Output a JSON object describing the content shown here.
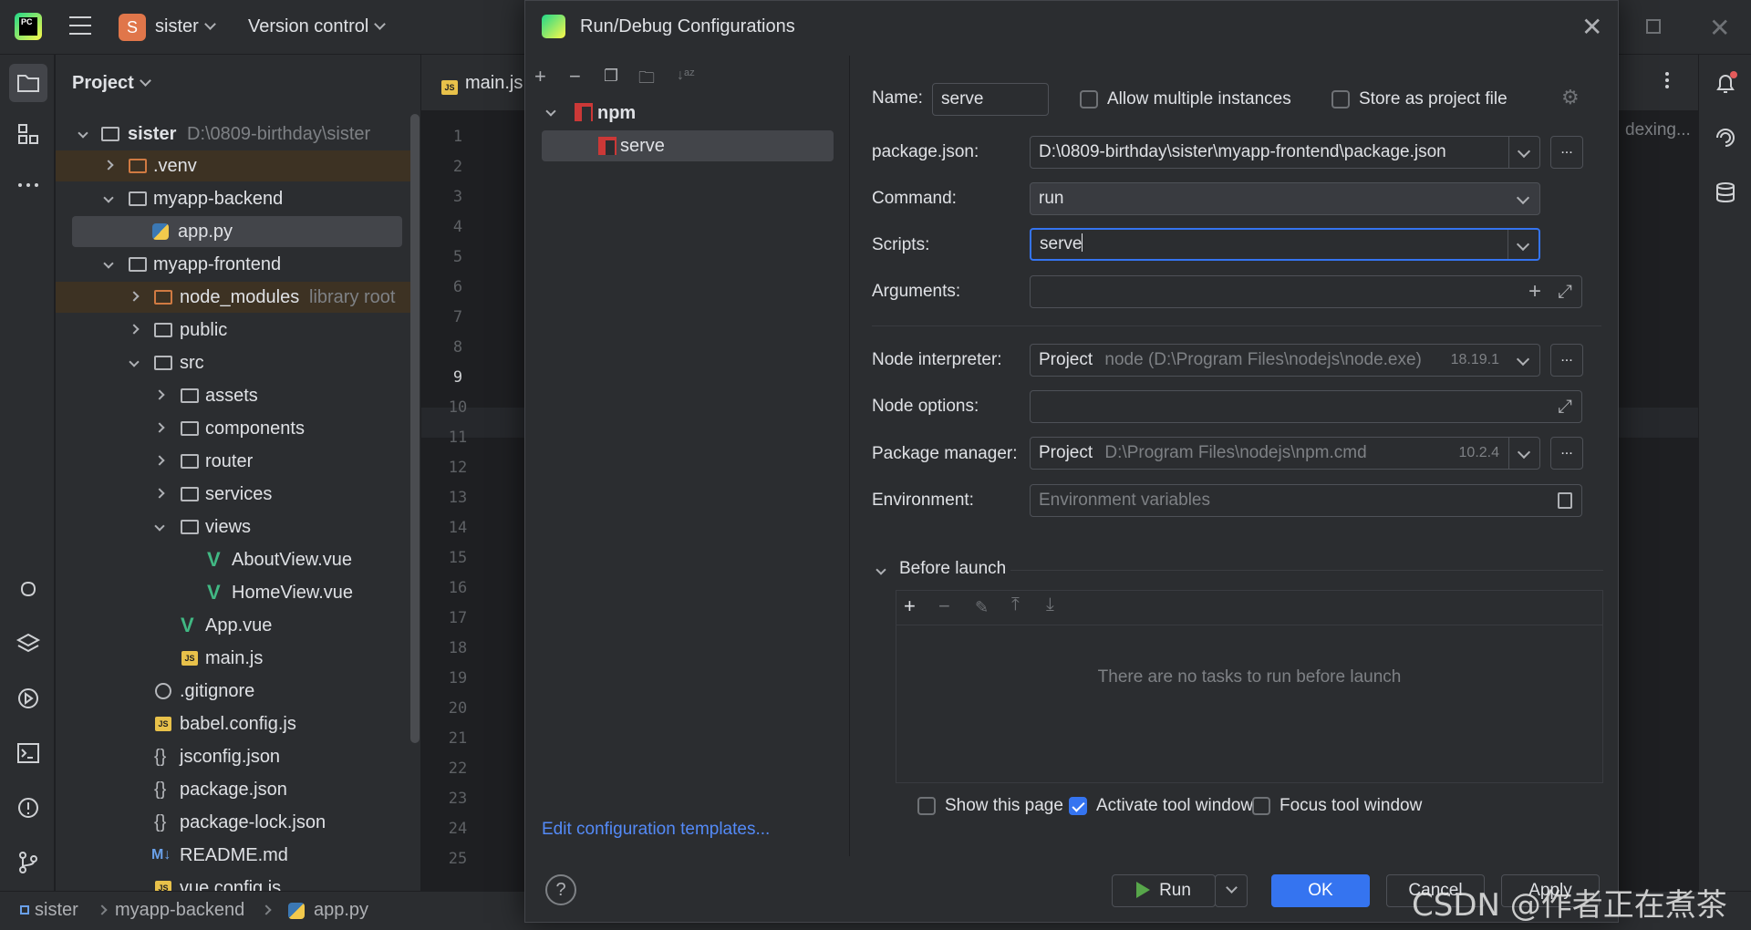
{
  "titlebar": {
    "project_initial": "S",
    "project_name": "sister",
    "vcs_label": "Version control"
  },
  "project_panel": {
    "title": "Project",
    "tree": [
      {
        "name": "sister",
        "path": "D:\\0809-birthday\\sister"
      },
      {
        "name": ".venv"
      },
      {
        "name": "myapp-backend"
      },
      {
        "name": "app.py"
      },
      {
        "name": "myapp-frontend"
      },
      {
        "name": "node_modules",
        "hint": "library root"
      },
      {
        "name": "public"
      },
      {
        "name": "src"
      },
      {
        "name": "assets"
      },
      {
        "name": "components"
      },
      {
        "name": "router"
      },
      {
        "name": "services"
      },
      {
        "name": "views"
      },
      {
        "name": "AboutView.vue"
      },
      {
        "name": "HomeView.vue"
      },
      {
        "name": "App.vue"
      },
      {
        "name": "main.js"
      },
      {
        "name": ".gitignore"
      },
      {
        "name": "babel.config.js"
      },
      {
        "name": "jsconfig.json"
      },
      {
        "name": "package.json"
      },
      {
        "name": "package-lock.json"
      },
      {
        "name": "README.md"
      },
      {
        "name": "vue.config.js"
      }
    ]
  },
  "editor": {
    "tab": "main.js",
    "line_numbers": [
      "1",
      "2",
      "3",
      "4",
      "5",
      "6",
      "7",
      "8",
      "9",
      "10",
      "11",
      "12",
      "13",
      "14",
      "15",
      "16",
      "17",
      "18",
      "19",
      "20",
      "21",
      "22",
      "23",
      "24",
      "25"
    ],
    "indexing": "dexing..."
  },
  "dialog": {
    "title": "Run/Debug Configurations",
    "tree": {
      "group": "npm",
      "item": "serve"
    },
    "edit_templates": "Edit configuration templates...",
    "name_label": "Name:",
    "name_value": "serve",
    "allow_multiple": "Allow multiple instances",
    "store_project": "Store as project file",
    "package_json_label": "package.json:",
    "package_json_value": "D:\\0809-birthday\\sister\\myapp-frontend\\package.json",
    "command_label": "Command:",
    "command_value": "run",
    "scripts_label": "Scripts:",
    "scripts_value": "serve",
    "arguments_label": "Arguments:",
    "node_interp_label": "Node interpreter:",
    "node_interp_scope": "Project",
    "node_interp_path": "node (D:\\Program Files\\nodejs\\node.exe)",
    "node_interp_version": "18.19.1",
    "node_options_label": "Node options:",
    "pkg_manager_label": "Package manager:",
    "pkg_manager_scope": "Project",
    "pkg_manager_path": "D:\\Program Files\\nodejs\\npm.cmd",
    "pkg_manager_version": "10.2.4",
    "environment_label": "Environment:",
    "environment_placeholder": "Environment variables",
    "before_launch_label": "Before launch",
    "before_launch_empty": "There are no tasks to run before launch",
    "show_page": "Show this page",
    "activate_tool": "Activate tool window",
    "activate_tool_checked": true,
    "focus_tool": "Focus tool window",
    "ellipsis": "...",
    "buttons": {
      "run": "Run",
      "ok": "OK",
      "cancel": "Cancel",
      "apply": "Apply",
      "help": "?"
    }
  },
  "statusbar": {
    "breadcrumbs": [
      "sister",
      "myapp-backend",
      "app.py"
    ]
  },
  "watermark": "CSDN @作者正在煮茶",
  "colors": {
    "accent": "#3574f0",
    "background": "#1e1f22",
    "panel": "#2b2d30",
    "npm": "#cb3837"
  }
}
